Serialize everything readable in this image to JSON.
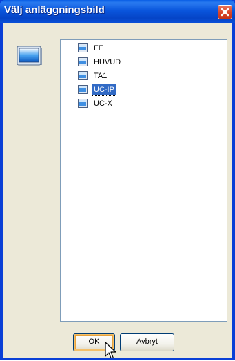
{
  "window": {
    "title": "Välj anläggningsbild"
  },
  "tree": {
    "items": [
      {
        "label": "FF",
        "selected": false
      },
      {
        "label": "HUVUD",
        "selected": false
      },
      {
        "label": "TA1",
        "selected": false
      },
      {
        "label": "UC-IP",
        "selected": true
      },
      {
        "label": "UC-X",
        "selected": false
      }
    ]
  },
  "buttons": {
    "ok_label": "OK",
    "cancel_label": "Avbryt"
  },
  "icons": {
    "close": "close-icon",
    "side": "screen-icon",
    "node": "screen-icon",
    "cursor": "mouse-pointer-icon"
  }
}
